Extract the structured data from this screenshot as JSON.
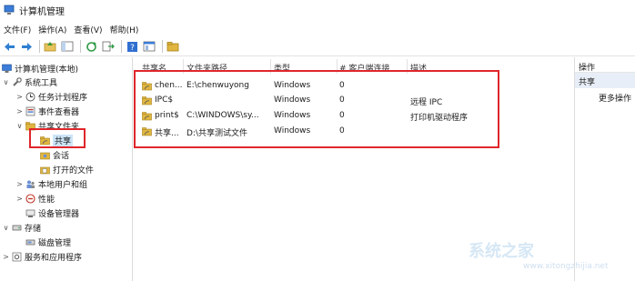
{
  "window": {
    "title": "计算机管理"
  },
  "menu": [
    "文件(F)",
    "操作(A)",
    "查看(V)",
    "帮助(H)"
  ],
  "toolbar": [
    "back-icon",
    "forward-icon",
    "up-icon",
    "show-hide-tree-icon",
    "refresh-icon",
    "export-icon",
    "help-icon",
    "properties-icon",
    "share-icon"
  ],
  "tree": [
    {
      "label": "计算机管理(本地)",
      "icon": "computer-management-icon",
      "expander": "",
      "level": 0
    },
    {
      "label": "系统工具",
      "icon": "tools-icon",
      "expander": "∨",
      "level": 1
    },
    {
      "label": "任务计划程序",
      "icon": "clock-icon",
      "expander": ">",
      "level": 2
    },
    {
      "label": "事件查看器",
      "icon": "event-viewer-icon",
      "expander": ">",
      "level": 2
    },
    {
      "label": "共享文件夹",
      "icon": "shared-folder-icon",
      "expander": "∨",
      "level": 2
    },
    {
      "label": "共享",
      "icon": "share-icon",
      "expander": "",
      "level": 3,
      "selected": true
    },
    {
      "label": "会话",
      "icon": "sessions-icon",
      "expander": "",
      "level": 3
    },
    {
      "label": "打开的文件",
      "icon": "open-files-icon",
      "expander": "",
      "level": 3
    },
    {
      "label": "本地用户和组",
      "icon": "users-icon",
      "expander": ">",
      "level": 2
    },
    {
      "label": "性能",
      "icon": "performance-icon",
      "expander": ">",
      "level": 2
    },
    {
      "label": "设备管理器",
      "icon": "device-manager-icon",
      "expander": "",
      "level": 2
    },
    {
      "label": "存储",
      "icon": "storage-icon",
      "expander": "∨",
      "level": 1
    },
    {
      "label": "磁盘管理",
      "icon": "disk-icon",
      "expander": "",
      "level": 2
    },
    {
      "label": "服务和应用程序",
      "icon": "services-icon",
      "expander": ">",
      "level": 1
    }
  ],
  "list": {
    "columns": [
      "共享名",
      "文件夹路径",
      "类型",
      "# 客户端连接",
      "描述"
    ],
    "rows": [
      {
        "name": "chen...",
        "path": "E:\\chenwuyong",
        "type": "Windows",
        "clients": "0",
        "desc": ""
      },
      {
        "name": "IPC$",
        "path": "",
        "type": "Windows",
        "clients": "0",
        "desc": "远程 IPC"
      },
      {
        "name": "print$",
        "path": "C:\\WINDOWS\\sy...",
        "type": "Windows",
        "clients": "0",
        "desc": "打印机驱动程序"
      },
      {
        "name": "共享...",
        "path": "D:\\共享测试文件",
        "type": "Windows",
        "clients": "0",
        "desc": ""
      }
    ]
  },
  "actions": {
    "header": "操作",
    "section": "共享",
    "more": "更多操作"
  },
  "watermark": {
    "text": "系统之家",
    "sub": "www.xitongzhijia.net"
  },
  "colors": {
    "highlight": "#e0262b",
    "selected": "#cce4f7",
    "folder": "#d9a92e"
  }
}
